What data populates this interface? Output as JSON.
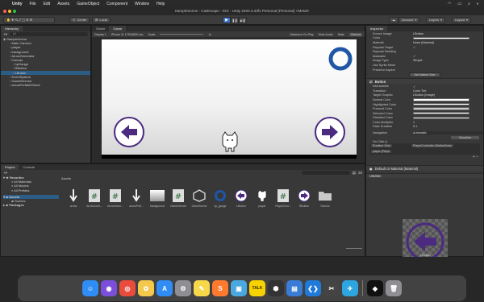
{
  "menubar": {
    "items": [
      "Unity",
      "File",
      "Edit",
      "Assets",
      "GameObject",
      "Component",
      "Window",
      "Help"
    ],
    "clock": "",
    "status_icons": [
      "wifi-icon",
      "battery-icon",
      "search-icon",
      "control-center-icon"
    ]
  },
  "window_title": "SampleScene - CatEscape - iOS - Unity 2020.3.33f1 Personal (Personal) <Metal>",
  "toolbar": {
    "center_label": "Center",
    "local_label": "Local",
    "account_label": "Account",
    "layers_label": "Layers",
    "layout_label": "Layout"
  },
  "hierarchy": {
    "tab": "Hierarchy",
    "search_placeholder": "All",
    "items": [
      {
        "label": "SampleScene",
        "indent": 0
      },
      {
        "label": "Main Camera",
        "indent": 2
      },
      {
        "label": "player",
        "indent": 2
      },
      {
        "label": "background",
        "indent": 2
      },
      {
        "label": "ArrowGenerator",
        "indent": 2
      },
      {
        "label": "Canvas",
        "indent": 2
      },
      {
        "label": "hpGauge",
        "indent": 3
      },
      {
        "label": "RButton",
        "indent": 3
      },
      {
        "label": "LButton",
        "indent": 3,
        "selected": true
      },
      {
        "label": "EventSystem",
        "indent": 2
      },
      {
        "label": "GameDirector",
        "indent": 2
      },
      {
        "label": "arrowPrefabDSheet",
        "indent": 2
      }
    ]
  },
  "scene_tabs": [
    "Scene",
    "Game"
  ],
  "game_bar": {
    "display": "Display 1",
    "resolution": "iPhone 11 1792x828 Lan",
    "scale_label": "Scale",
    "scale_value": "1x",
    "options": [
      "Maximize On Play",
      "Mute Audio",
      "Stats",
      "Gizmos"
    ]
  },
  "inspector": {
    "tab": "Inspector",
    "rows": [
      {
        "label": "Source Image",
        "value": "LButton"
      },
      {
        "label": "Color",
        "value": "",
        "swatch": "#ffffff"
      },
      {
        "label": "Material",
        "value": "None (Material)"
      },
      {
        "label": "Raycast Target",
        "value": "✓"
      },
      {
        "label": "Raycast Padding",
        "value": ""
      },
      {
        "label": "Maskable",
        "value": "✓"
      },
      {
        "label": "Image Type",
        "value": "Simple"
      },
      {
        "label": "Use Sprite Mesh",
        "value": ""
      },
      {
        "label": "Preserve Aspect",
        "value": ""
      }
    ],
    "native_size_button": "Set Native Size",
    "button_section": "Button",
    "button_rows": [
      {
        "label": "Interactable",
        "value": "✓"
      },
      {
        "label": "Transition",
        "value": "Color Tint"
      },
      {
        "label": "Target Graphic",
        "value": "LButton (Image)"
      },
      {
        "label": "Normal Color",
        "value": "",
        "swatch": "#ffffff"
      },
      {
        "label": "Highlighted Color",
        "value": "",
        "swatch": "#f5f5f5"
      },
      {
        "label": "Pressed Color",
        "value": "",
        "swatch": "#c8c8c8"
      },
      {
        "label": "Selected Color",
        "value": "",
        "swatch": "#f5f5f5"
      },
      {
        "label": "Disabled Color",
        "value": "",
        "swatch": "#c8c8c8"
      },
      {
        "label": "Color Multiplier",
        "value": "1"
      },
      {
        "label": "Fade Duration",
        "value": "0.1"
      }
    ],
    "navigation_label": "Navigation",
    "navigation_value": "Automatic",
    "visualize_button": "Visualize",
    "onclick_label": "On Click ()",
    "runtime_value": "Runtime Only",
    "function_value": "PlayerController.LButtonDown",
    "object_value": "player (Playe",
    "material_label": "Default UI Material (Material)",
    "preview_title": "LButton",
    "preview_caption": "LButton\nImage Size: 181x174"
  },
  "project": {
    "tabs": [
      "Project",
      "Console"
    ],
    "favorites_label": "Favorites",
    "favorites": [
      "All Materials",
      "All Models",
      "All Prefabs"
    ],
    "assets_label": "Assets",
    "assets_tree": [
      "Scenes"
    ],
    "packages_label": "Packages",
    "breadcrumb": "Assets",
    "count": "26",
    "assets": [
      {
        "name": "arrow",
        "kind": "arrow-down"
      },
      {
        "name": "ArrowContr...",
        "kind": "script"
      },
      {
        "name": "ArrowGene...",
        "kind": "script"
      },
      {
        "name": "arrowPref...",
        "kind": "arrow-down"
      },
      {
        "name": "background",
        "kind": "gradient"
      },
      {
        "name": "GameDirector",
        "kind": "script"
      },
      {
        "name": "GameScene",
        "kind": "unity"
      },
      {
        "name": "hp_gauge",
        "kind": "ring"
      },
      {
        "name": "LButton",
        "kind": "lbutton"
      },
      {
        "name": "player",
        "kind": "cat"
      },
      {
        "name": "PlayerCont...",
        "kind": "script"
      },
      {
        "name": "RButton",
        "kind": "rbutton"
      },
      {
        "name": "Scenes",
        "kind": "folder"
      }
    ]
  },
  "colors": {
    "accent": "#3a72c7",
    "button_purple": "#4b2a80",
    "gauge_blue": "#1f56a6"
  },
  "dock": [
    {
      "name": "finder"
    },
    {
      "name": "siri"
    },
    {
      "name": "chrome"
    },
    {
      "name": "photos"
    },
    {
      "name": "appstore"
    },
    {
      "name": "settings"
    },
    {
      "name": "notes"
    },
    {
      "name": "sublime"
    },
    {
      "name": "preview"
    },
    {
      "name": "kakao",
      "label": "TALK"
    },
    {
      "name": "unity-hub"
    },
    {
      "name": "photos-2"
    },
    {
      "name": "vscode"
    },
    {
      "name": "tool"
    },
    {
      "name": "telegram"
    },
    {
      "name": "unity"
    },
    {
      "name": "trash"
    }
  ]
}
